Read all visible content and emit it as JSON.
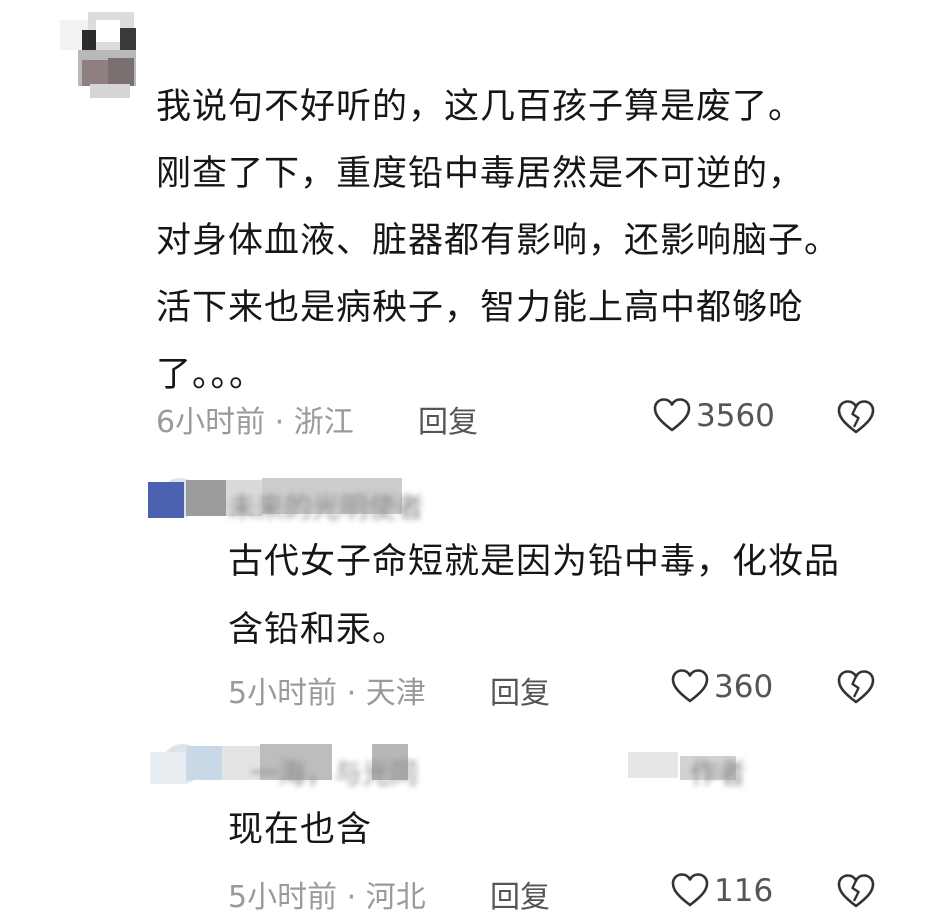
{
  "comment": {
    "text": "我说句不好听的，这几百孩子算是废了。\n刚查了下，重度铅中毒居然是不可逆的，\n对身体血液、脏器都有影响，还影响脑子。\n活下来也是病秧子，智力能上高中都够呛\n了。。。",
    "time_location": "6小时前 · 浙江",
    "reply_label": "回复",
    "likes": "3560"
  },
  "replies": [
    {
      "username": "未来的光明使者",
      "text": "古代女子命短就是因为铅中毒，化妆品\n含铅和汞。",
      "time_location": "5小时前 · 天津",
      "reply_label": "回复",
      "likes": "360"
    },
    {
      "username": "一海，与光同",
      "tag": "作者",
      "text": "现在也含",
      "time_location": "5小时前 · 河北",
      "reply_label": "回复",
      "likes": "116"
    }
  ],
  "icons": {
    "like": "heart-outline-icon",
    "dislike": "broken-heart-icon"
  },
  "colors": {
    "text": "#161616",
    "meta": "#9a9a9a",
    "blur_accent": "#4a62b0"
  }
}
